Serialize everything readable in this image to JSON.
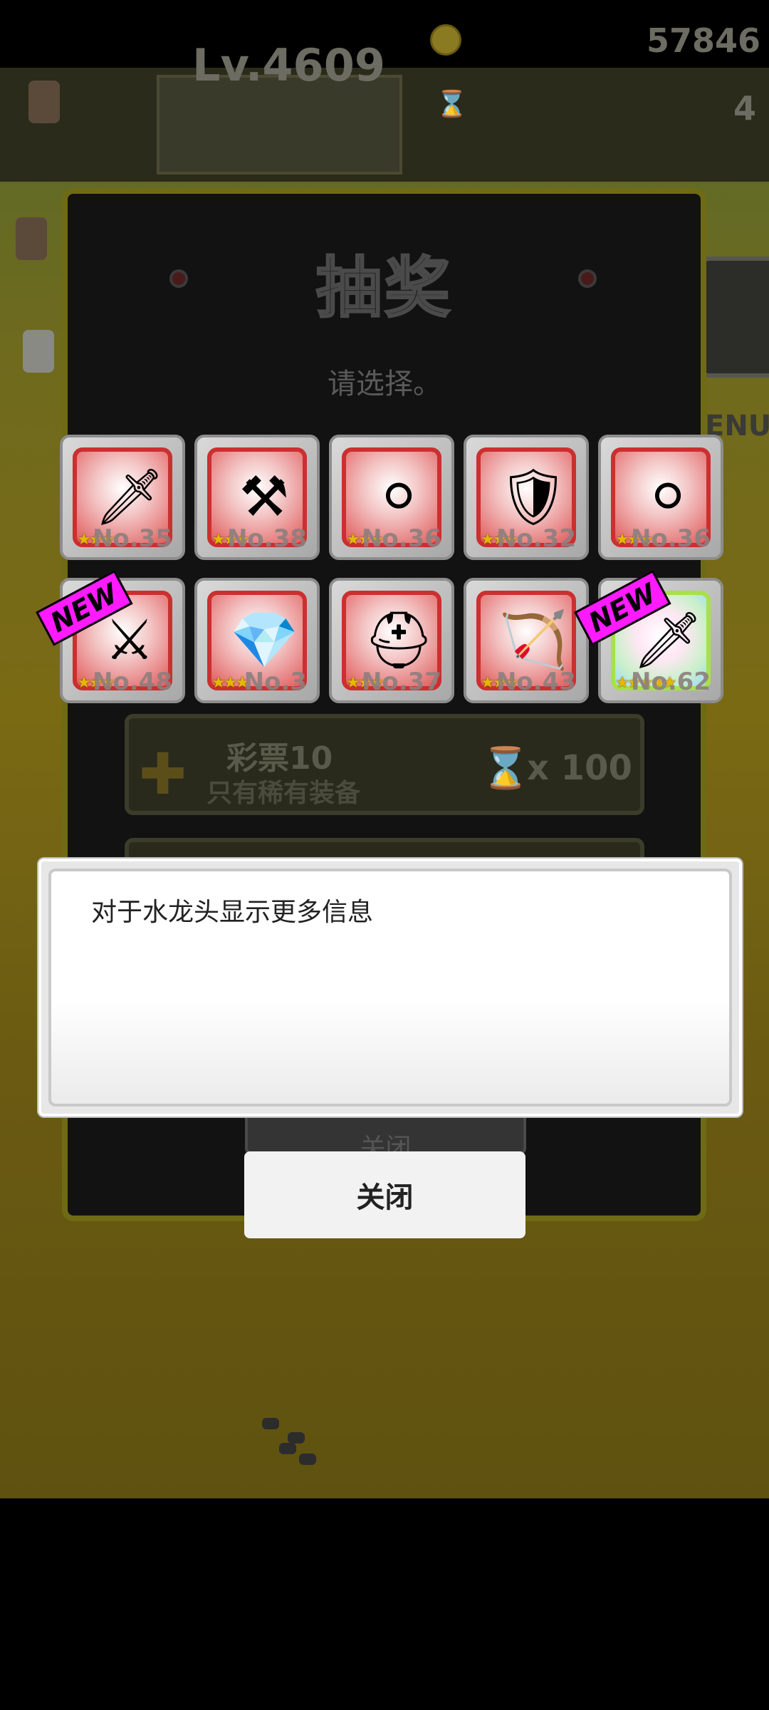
{
  "hud": {
    "level": "Lv.4609",
    "coins": "57846",
    "tickets": "4",
    "menu_label": "ENU"
  },
  "panel": {
    "title": "抽奖",
    "subtitle": "请选择。",
    "close_label_dimmed": "关闭"
  },
  "items": [
    {
      "glyph": "🗡",
      "stars": "★★★",
      "number": "No.35",
      "rarity": "red",
      "new": false
    },
    {
      "glyph": "⚒",
      "stars": "★★★",
      "number": "No.38",
      "rarity": "red",
      "new": false
    },
    {
      "glyph": "⚪",
      "stars": "★★★",
      "number": "No.36",
      "rarity": "red",
      "new": false
    },
    {
      "glyph": "🛡",
      "stars": "★★★",
      "number": "No.32",
      "rarity": "red",
      "new": false
    },
    {
      "glyph": "⚪",
      "stars": "★★★",
      "number": "No.36",
      "rarity": "red",
      "new": false
    },
    {
      "glyph": "⚔",
      "stars": "★★★",
      "number": "No.48",
      "rarity": "red",
      "new": true
    },
    {
      "glyph": "💎",
      "stars": "★★★",
      "number": "No.3",
      "rarity": "red",
      "new": false
    },
    {
      "glyph": "⛑",
      "stars": "★★★",
      "number": "No.37",
      "rarity": "red",
      "new": false
    },
    {
      "glyph": "🏹",
      "stars": "★★★",
      "number": "No.43",
      "rarity": "red",
      "new": false
    },
    {
      "glyph": "🗡",
      "stars": "★★★★★",
      "number": "No.62",
      "rarity": "rainbow",
      "new": true
    }
  ],
  "badge_text": "NEW",
  "lottery": {
    "name": "彩票10",
    "description": "只有稀有装备",
    "cost": "x 100"
  },
  "tooltip": {
    "text": "对于水龙头显示更多信息"
  },
  "close_button": {
    "label": "关闭"
  },
  "colors": {
    "badge": "#ff1aff",
    "slot_border_red": "#cc2f2f",
    "panel_border": "#6f6a14"
  }
}
